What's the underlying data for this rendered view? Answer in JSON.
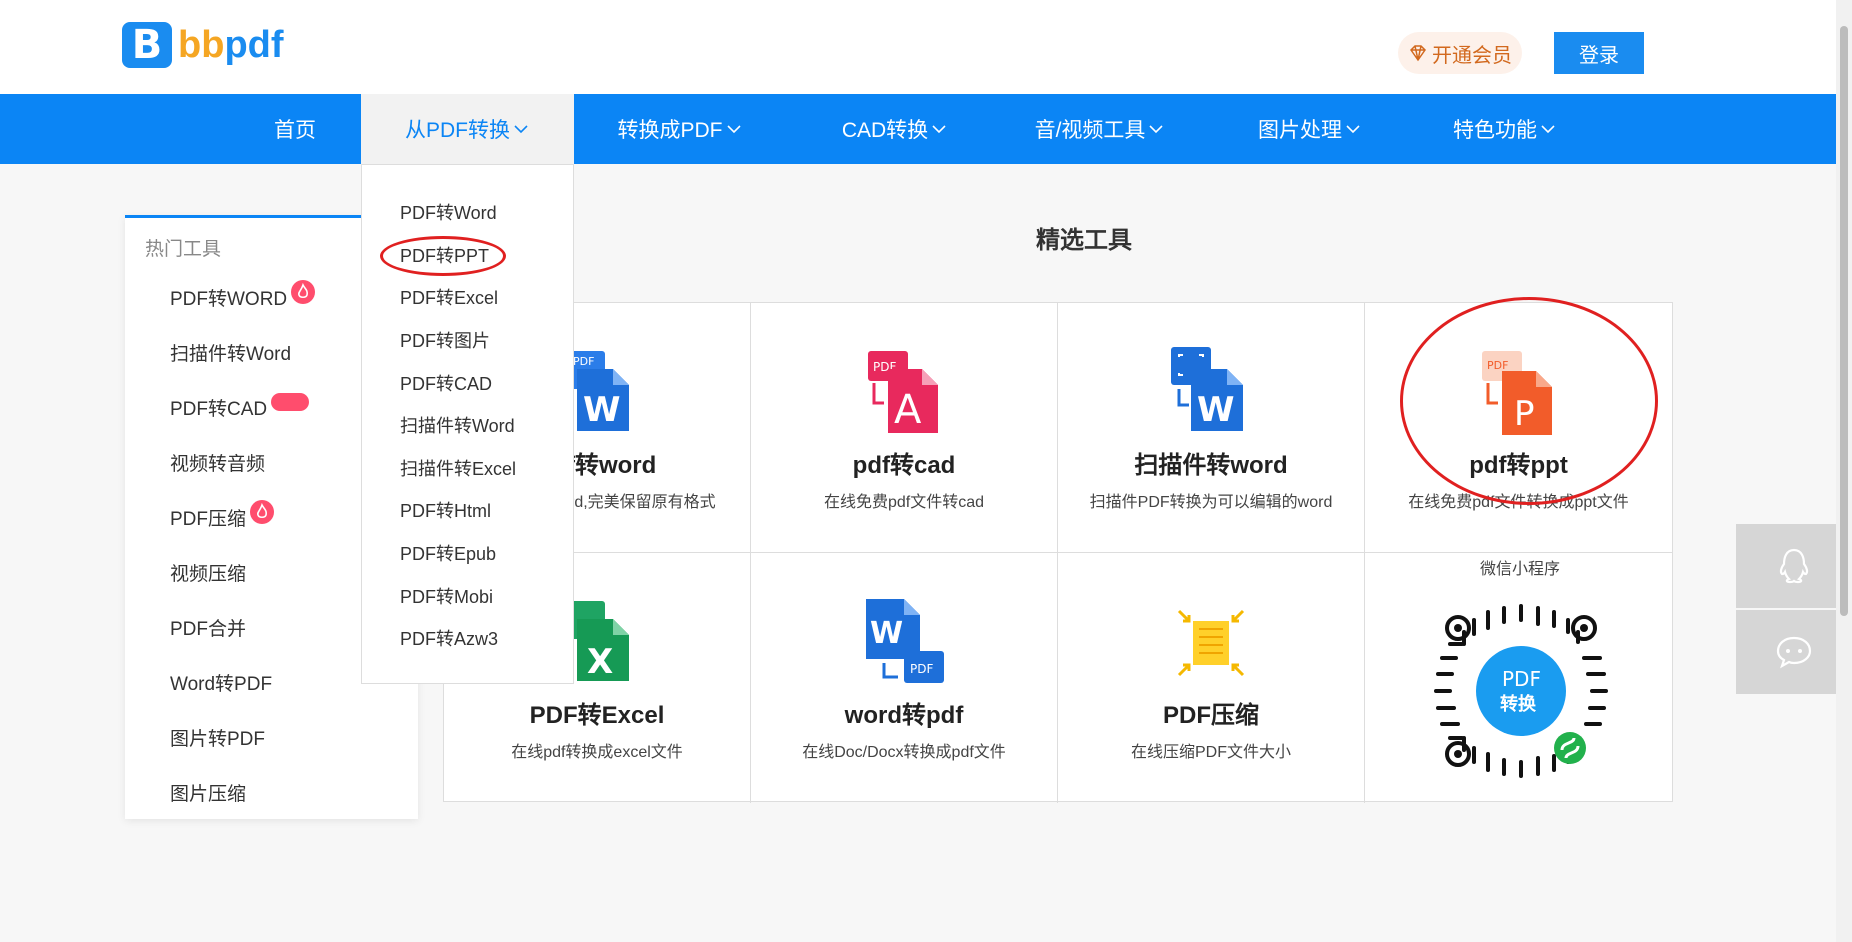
{
  "brand": {
    "logo_letter": "B",
    "name_part1": "bb",
    "name_part2": "pdf"
  },
  "header": {
    "vip_label": "开通会员",
    "login_label": "登录"
  },
  "nav": {
    "items": [
      {
        "label": "首页"
      },
      {
        "label": "从PDF转换"
      },
      {
        "label": "转换成PDF"
      },
      {
        "label": "CAD转换"
      },
      {
        "label": "音/视频工具"
      },
      {
        "label": "图片处理"
      },
      {
        "label": "特色功能"
      }
    ]
  },
  "dropdown": {
    "items": [
      "PDF转Word",
      "PDF转PPT",
      "PDF转Excel",
      "PDF转图片",
      "PDF转CAD",
      "扫描件转Word",
      "扫描件转Excel",
      "PDF转Html",
      "PDF转Epub",
      "PDF转Mobi",
      "PDF转Azw3"
    ]
  },
  "sidebar": {
    "title": "热门工具",
    "items": [
      "PDF转WORD",
      "扫描件转Word",
      "PDF转CAD",
      "视频转音频",
      "PDF压缩",
      "视频压缩",
      "PDF合并",
      "Word转PDF",
      "图片转PDF",
      "图片压缩"
    ]
  },
  "main": {
    "title": "精选工具",
    "tools": [
      {
        "title": "pdf转word",
        "desc": "在线pdf转word,完美保留原有格式"
      },
      {
        "title": "pdf转cad",
        "desc": "在线免费pdf文件转cad"
      },
      {
        "title": "扫描件转word",
        "desc": "扫描件PDF转换为可以编辑的word"
      },
      {
        "title": "pdf转ppt",
        "desc": "在线免费pdf文件转换成ppt文件"
      },
      {
        "title": "PDF转Excel",
        "desc": "在线pdf转换成excel文件"
      },
      {
        "title": "word转pdf",
        "desc": "在线Doc/Docx转换成pdf文件"
      },
      {
        "title": "PDF压缩",
        "desc": "在线压缩PDF文件大小"
      }
    ],
    "wechat_label": "微信小程序",
    "qr_text1": "PDF",
    "qr_text2": "转换"
  },
  "icon_text": {
    "pdf": "PDF",
    "w": "W",
    "x": "X",
    "p": "P",
    "a": "A"
  },
  "colors": {
    "nav": "#0b85f5",
    "accent": "#1a8cf0",
    "highlight": "#e02020"
  }
}
